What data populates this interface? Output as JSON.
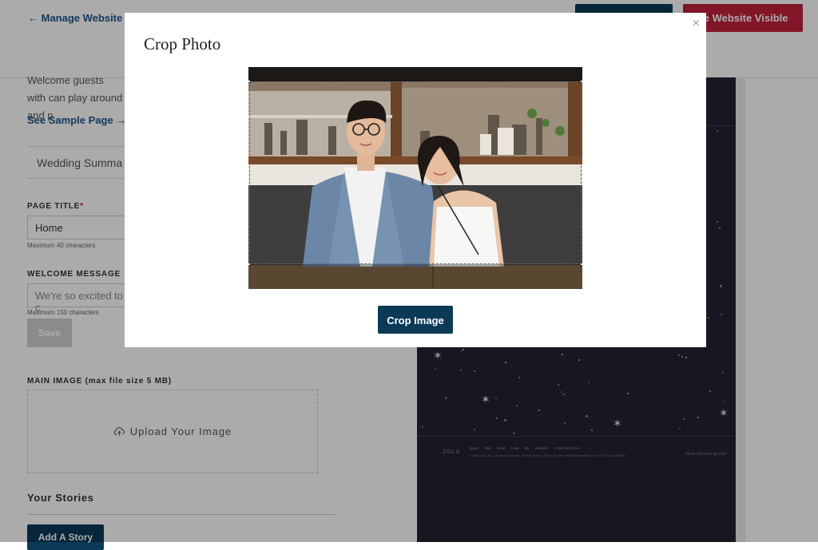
{
  "header": {
    "back_label": "Manage Website",
    "visible_button_label": "ke Website Visible"
  },
  "page": {
    "intro_text": "Welcome guests with can play around and p",
    "sample_link": "See Sample Page",
    "section_title": "Wedding Summa",
    "page_title_label": "PAGE TITLE",
    "page_title_value": "Home",
    "page_title_hint": "Maximum 40 characters",
    "welcome_label": "WELCOME MESSAGE",
    "welcome_placeholder": "We're so excited to c",
    "welcome_hint": "Maximum 150 characters",
    "save_label": "Save",
    "main_image_label": "MAIN IMAGE (max file size 5 MB)",
    "upload_label": "Upload Your Image",
    "stories_title": "Your Stories",
    "add_story_label": "Add A Story"
  },
  "preview": {
    "footer_logo": "ZOLA",
    "footer_links": "About Zola  Need Help  My Website  1-408-512-ZOLA",
    "footer_copy": "© 2020 Zola, Inc. All rights reserved. Privacy Policy / Terms of Use / Web Accessibility / Your CA Privacy Rights",
    "footer_made": "Made with love by Zola"
  },
  "modal": {
    "title": "Crop Photo",
    "close_glyph": "×",
    "crop_button_label": "Crop Image"
  },
  "colors": {
    "brand_navy": "#0b3a57",
    "brand_red": "#c0213c",
    "link_blue": "#21578a",
    "preview_bg": "#242332"
  },
  "icons": [
    "arrow-left-icon",
    "arrow-right-icon",
    "cloud-upload-icon",
    "close-icon"
  ]
}
